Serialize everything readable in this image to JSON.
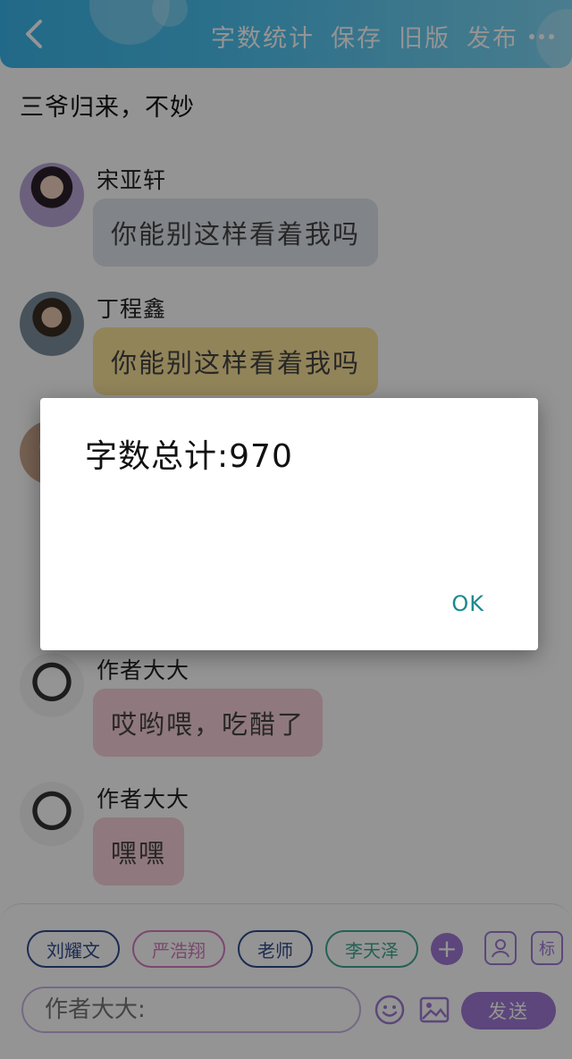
{
  "header": {
    "back_icon": "chevron-left-icon",
    "actions": [
      "字数统计",
      "保存",
      "旧版",
      "发布"
    ],
    "more_icon": "more-dots-icon"
  },
  "chat": {
    "title": "三爷归来，不妙",
    "messages": [
      {
        "sender": "宋亚轩",
        "text": "你能别这样看着我吗",
        "bubble_color": "#dfe3ea"
      },
      {
        "sender": "丁程鑫",
        "text": "你能别这样看着我吗",
        "bubble_color": "#fce49a"
      },
      {
        "sender": "作者大大",
        "text": "哎哟喂，吃醋了",
        "bubble_color": "#f7cfd9"
      },
      {
        "sender": "作者大大",
        "text": "嘿嘿",
        "bubble_color": "#f7cfd9"
      }
    ]
  },
  "input_area": {
    "chips": [
      {
        "label": "刘耀文",
        "color": "#2f4a8a"
      },
      {
        "label": "严浩翔",
        "color": "#d67bc0"
      },
      {
        "label": "老师",
        "color": "#2f4a8a"
      },
      {
        "label": "李天泽",
        "color": "#3fa890"
      }
    ],
    "add_icon": "plus-icon",
    "role_icon": "person-card-icon",
    "tag_label": "标",
    "input_placeholder": "作者大大:",
    "emoji_icon": "smile-icon",
    "image_icon": "image-icon",
    "send_label": "发送",
    "accent": "#9f79d4"
  },
  "dialog": {
    "message": "字数总计:970",
    "ok_label": "OK",
    "ok_color": "#1a8a8f"
  }
}
